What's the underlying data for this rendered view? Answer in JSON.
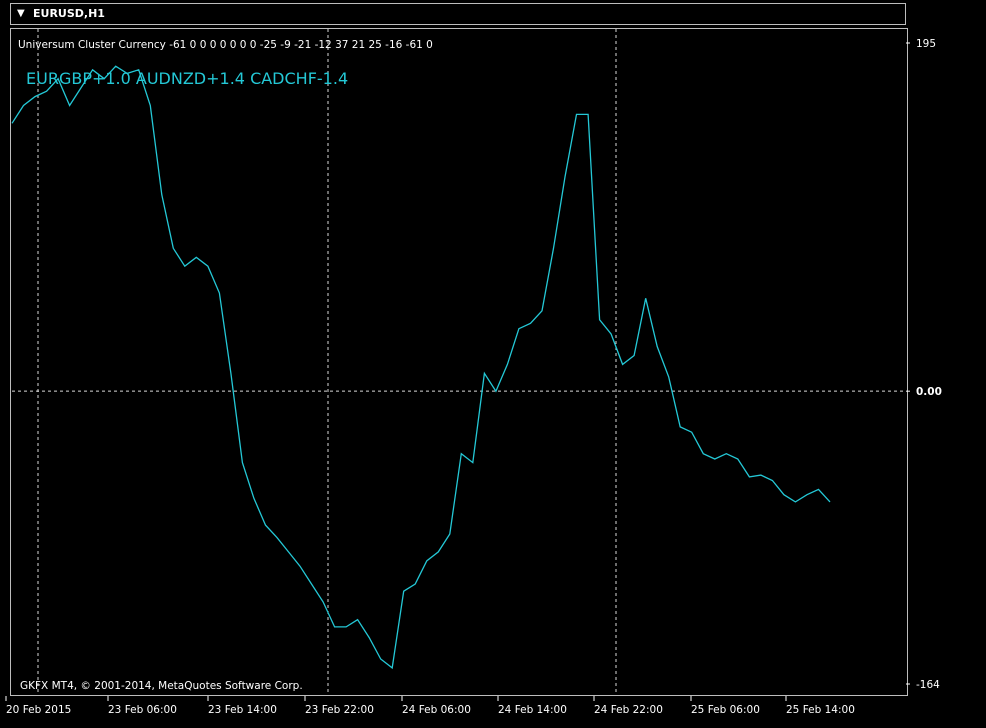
{
  "window": {
    "title": "EURUSD,H1",
    "menu_icon": "dropdown-triangle-icon"
  },
  "indicator": {
    "header": "Universum Cluster Currency -61 0 0 0 0 0 0 0 -25 -9 -21 -12 37 21 25 -16 -61 0",
    "pairs_text": "EURGBP+1.0 AUDNZD+1.4 CADCHF-1.4"
  },
  "copyright": "GKFX MT4, © 2001-2014, MetaQuotes Software Corp.",
  "colors": {
    "background": "#000000",
    "line": "#24c8d6",
    "grid": "#ffffff",
    "text": "#ffffff",
    "frame": "#bdbdbd"
  },
  "chart_data": {
    "type": "line",
    "y_scale_labels": [
      "195",
      "0.00",
      "-164"
    ],
    "ylim": [
      -164,
      195
    ],
    "x_tick_labels": [
      "20 Feb 2015",
      "23 Feb 06:00",
      "23 Feb 14:00",
      "23 Feb 22:00",
      "24 Feb 06:00",
      "24 Feb 14:00",
      "24 Feb 22:00",
      "25 Feb 06:00",
      "25 Feb 14:00"
    ],
    "grid": "dashed, vertical at 23 Feb 06:00, 23 Feb 22:00, 24 Feb 22:00; horizontal at 0.00",
    "series": [
      {
        "values": [
          150,
          160,
          165,
          168,
          175,
          160,
          170,
          180,
          175,
          182,
          178,
          180,
          160,
          110,
          80,
          70,
          75,
          70,
          55,
          10,
          -40,
          -60,
          -75,
          -82,
          -90,
          -98,
          -108,
          -118,
          -132,
          -132,
          -128,
          -138,
          -150,
          -155,
          -112,
          -108,
          -95,
          -90,
          -80,
          -35,
          -40,
          10,
          0,
          15,
          35,
          38,
          45,
          80,
          120,
          155,
          155,
          40,
          32,
          15,
          20,
          52,
          25,
          8,
          -20,
          -23,
          -35,
          -38,
          -35,
          -38,
          -48,
          -47,
          -50,
          -58,
          -62,
          -58,
          -55,
          -62
        ]
      }
    ]
  }
}
